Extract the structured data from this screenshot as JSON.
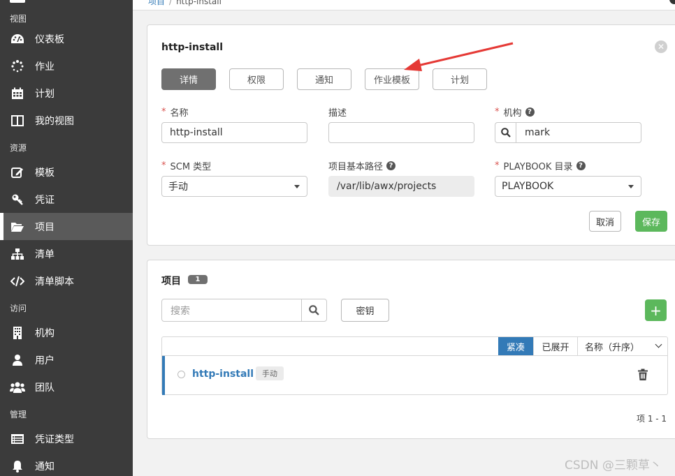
{
  "breadcrumb": {
    "parent": "项目",
    "separator": "/",
    "current": "http-install"
  },
  "sidebar": {
    "sections": {
      "views": "视图",
      "resources": "资源",
      "access": "访问",
      "admin": "管理"
    },
    "items": [
      {
        "label": "仪表板",
        "icon": "dashboard-icon"
      },
      {
        "label": "作业",
        "icon": "spinner-icon"
      },
      {
        "label": "计划",
        "icon": "calendar-icon"
      },
      {
        "label": "我的视图",
        "icon": "columns-icon"
      },
      {
        "label": "模板",
        "icon": "edit-icon"
      },
      {
        "label": "凭证",
        "icon": "key-icon"
      },
      {
        "label": "项目",
        "icon": "folder-open-icon",
        "active": true
      },
      {
        "label": "清单",
        "icon": "sitemap-icon"
      },
      {
        "label": "清单脚本",
        "icon": "code-icon"
      },
      {
        "label": "机构",
        "icon": "building-icon"
      },
      {
        "label": "用户",
        "icon": "user-icon"
      },
      {
        "label": "团队",
        "icon": "users-icon"
      },
      {
        "label": "凭证类型",
        "icon": "list-alt-icon"
      },
      {
        "label": "通知",
        "icon": "bell-icon"
      }
    ]
  },
  "detail": {
    "title": "http-install",
    "tabs": [
      "详情",
      "权限",
      "通知",
      "作业模板",
      "计划"
    ],
    "active_tab": "详情",
    "fields": {
      "name": {
        "label": "名称",
        "required": true,
        "value": "http-install"
      },
      "description": {
        "label": "描述",
        "required": false,
        "value": ""
      },
      "organization": {
        "label": "机构",
        "required": true,
        "value": "mark"
      },
      "scm_type": {
        "label": "SCM 类型",
        "required": true,
        "value": "手动"
      },
      "base_path": {
        "label": "项目基本路径",
        "required": false,
        "value": "/var/lib/awx/projects"
      },
      "playbook_dir": {
        "label": "PLAYBOOK 目录",
        "required": true,
        "value": "PLAYBOOK"
      }
    },
    "buttons": {
      "cancel": "取消",
      "save": "保存"
    }
  },
  "projects_list": {
    "title": "项目",
    "count": "1",
    "search_placeholder": "搜索",
    "key_button": "密钥",
    "add_button": "+",
    "view_toggle": {
      "compact": "紧凑",
      "expanded": "已展开"
    },
    "sort": "名称（升序）",
    "rows": [
      {
        "name": "http-install",
        "scm_tag": "手动"
      }
    ],
    "pagination": "项  1 - 1"
  },
  "colors": {
    "sidebar_bg": "#3b3b3b",
    "accent_blue": "#337ab7",
    "success_green": "#5cb85c",
    "required_red": "#d9534f",
    "annotation_arrow": "#e53935"
  },
  "watermark": "CSDN @三颗草丶"
}
